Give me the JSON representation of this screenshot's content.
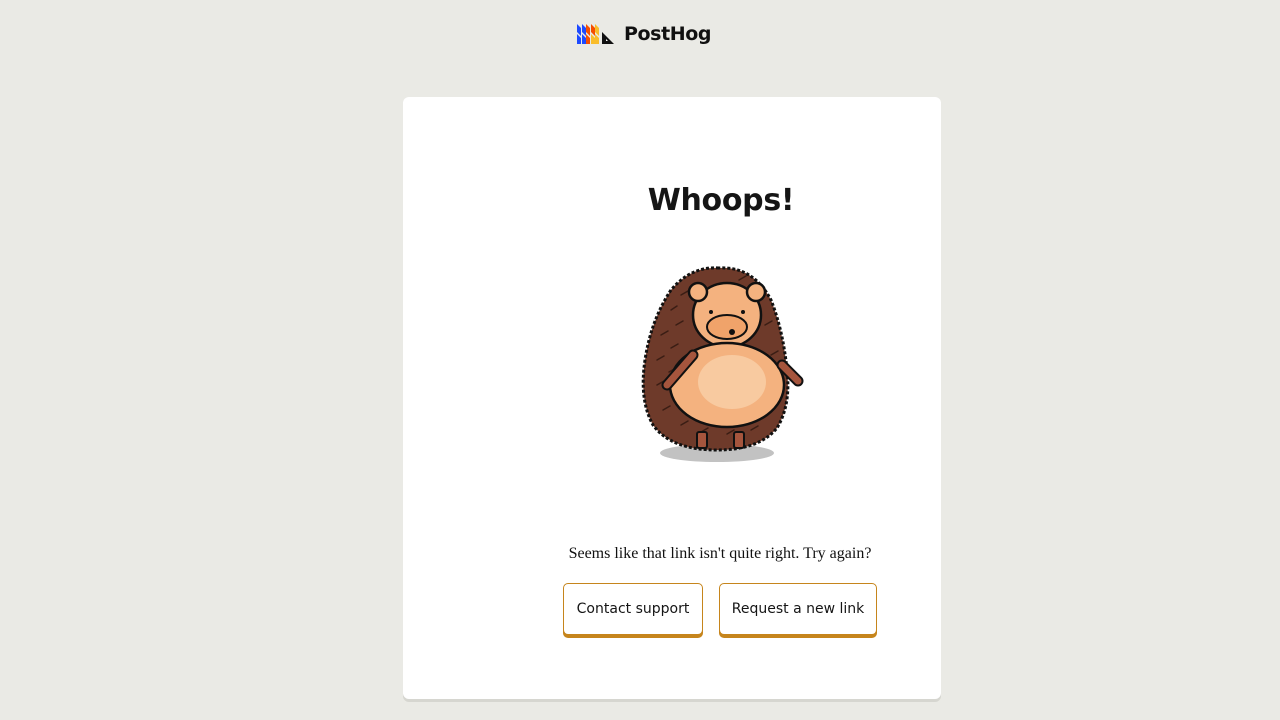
{
  "header": {
    "brand_name": "PostHog",
    "logo_icon": "posthog-logo-icon"
  },
  "card": {
    "title": "Whoops!",
    "illustration": "hedgehog-illustration",
    "message": "Seems like that link isn't quite right. Try again?",
    "buttons": {
      "contact_support": "Contact support",
      "request_new_link": "Request a new link"
    }
  },
  "colors": {
    "page_background": "#eaeae5",
    "card_background": "#ffffff",
    "button_accent": "#c6851c",
    "logo_blue": "#1d4aff",
    "logo_orange": "#f54e00",
    "logo_yellow": "#f9bd2b"
  }
}
